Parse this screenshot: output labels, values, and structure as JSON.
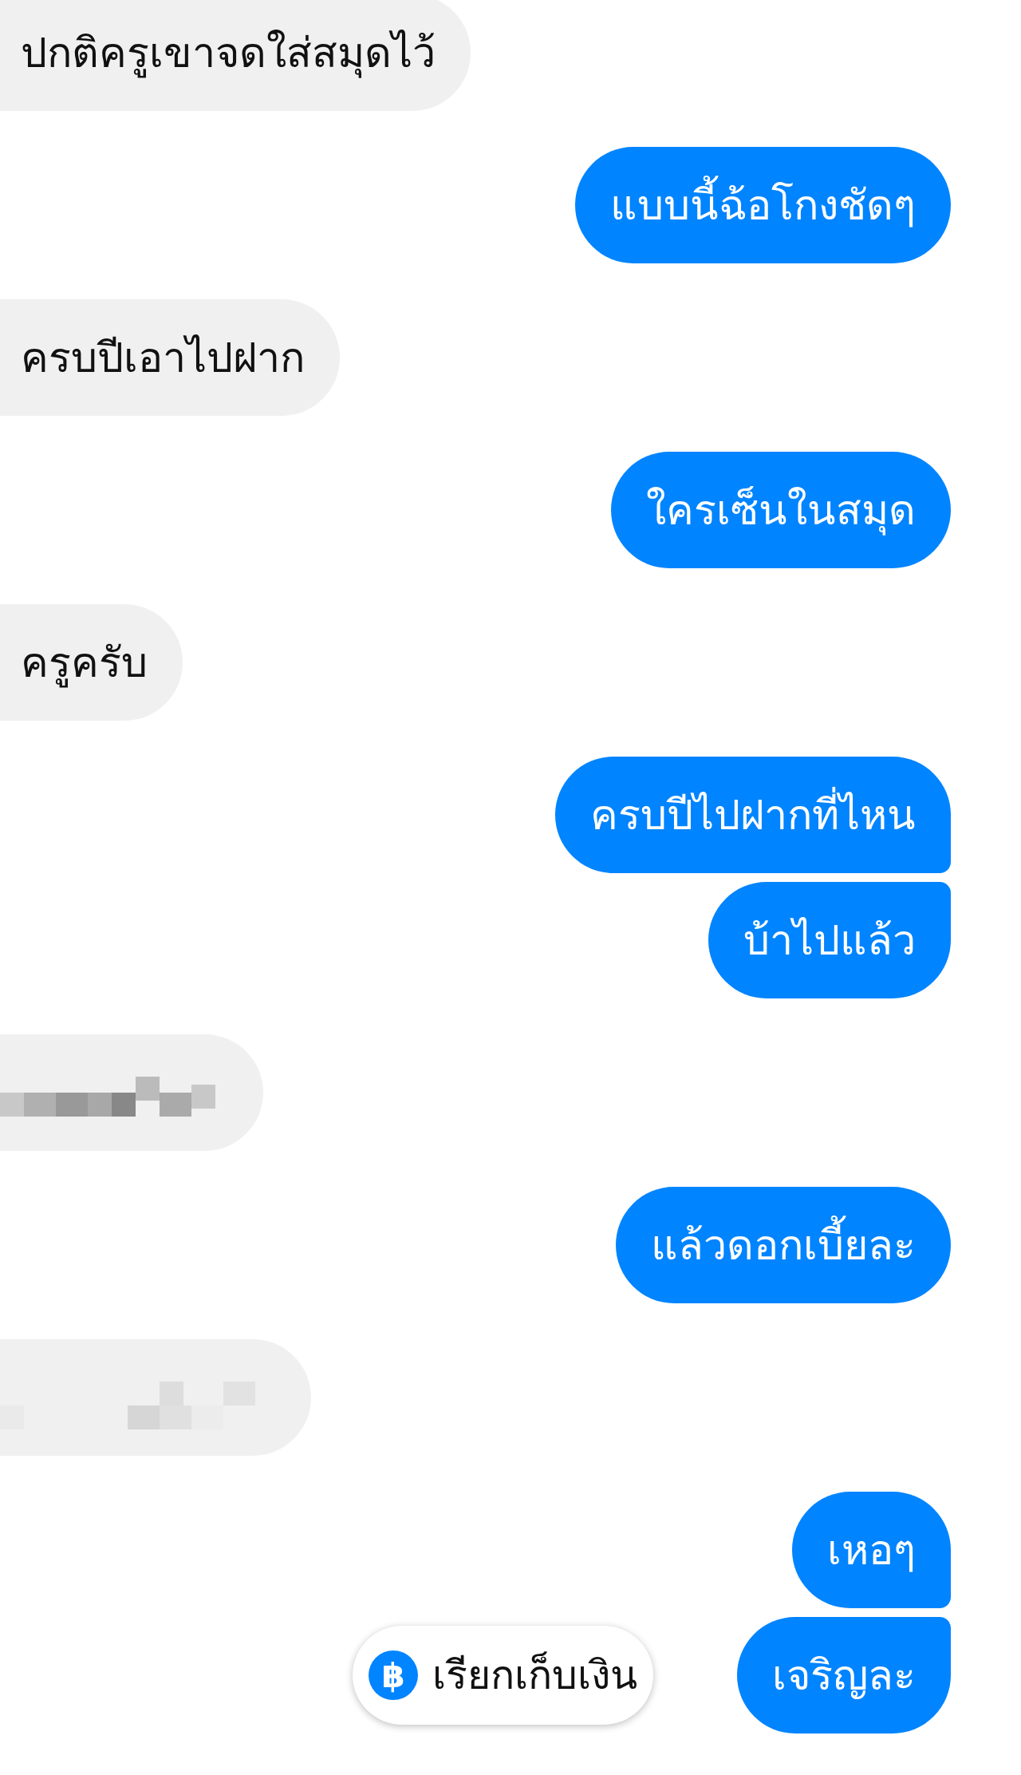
{
  "messages": [
    {
      "outgoing": false,
      "kind": "text",
      "text": "ปกติครูเขาจดใส่สมุดไว้"
    },
    {
      "outgoing": true,
      "kind": "text",
      "text": "แบบนี้ฉ้อโกงชัดๆ"
    },
    {
      "outgoing": false,
      "kind": "text",
      "text": "ครบปีเอาไปฝาก"
    },
    {
      "outgoing": true,
      "kind": "text",
      "text": "ใครเซ็นในสมุด"
    },
    {
      "outgoing": false,
      "kind": "text",
      "text": "ครูครับ"
    },
    {
      "outgoing": true,
      "kind": "text",
      "text": "ครบปีไปฝากที่ไหน"
    },
    {
      "outgoing": true,
      "kind": "text",
      "text": "บ้าไปแล้ว"
    },
    {
      "outgoing": false,
      "kind": "redacted"
    },
    {
      "outgoing": true,
      "kind": "text",
      "text": "แล้วดอกเบี้ยละ"
    },
    {
      "outgoing": false,
      "kind": "redacted"
    },
    {
      "outgoing": true,
      "kind": "text",
      "text": "เหอๆ"
    },
    {
      "outgoing": true,
      "kind": "text",
      "text": "เจริญละ"
    }
  ],
  "request_payment": {
    "icon": "฿",
    "label": "เรียกเก็บเงิน"
  }
}
